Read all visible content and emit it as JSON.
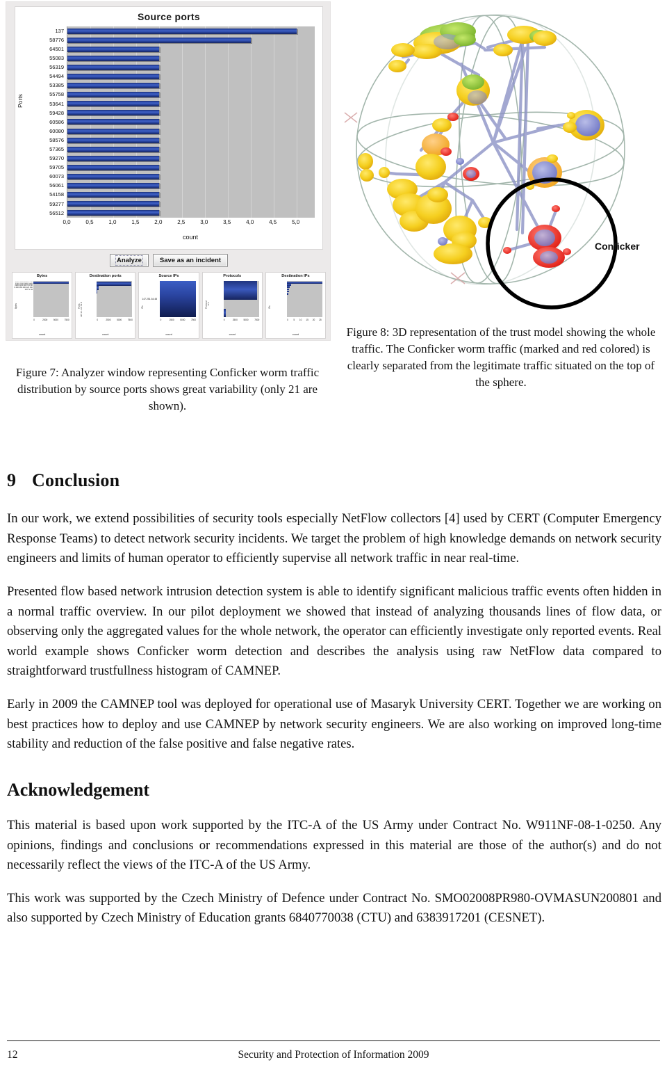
{
  "figure7": {
    "window_name": "Analyzer window",
    "chart_title": "Source ports",
    "buttons": [
      {
        "label": "Analyze",
        "name": "analyze-button"
      },
      {
        "label": "Save as an incident",
        "name": "save-as-incident-button"
      }
    ],
    "mini_charts": [
      {
        "title": "Bytes",
        "ylabel": "Bytes",
        "xlabel": "count",
        "xticks": [
          "0",
          "2500",
          "5000",
          "7500"
        ],
        "yticks": "4050 3564 3080 2700 2400 2100 1800 1560 1320 1100 920 740 600 480 380 290 220 160 110 72 44",
        "bars": [
          100
        ]
      },
      {
        "title": "Destination ports",
        "ylabel": "Ports",
        "xlabel": "count",
        "xticks": [
          "0",
          "2500",
          "5000",
          "7500"
        ],
        "yticks": "445  3  1  137  50  80",
        "bars": [
          97,
          5,
          2
        ]
      },
      {
        "title": "Source IPs",
        "ylabel": "IPs",
        "xlabel": "count",
        "xticks": [
          "0",
          "2500",
          "5000",
          "7500"
        ],
        "side_value": "147.251.54.48",
        "bars": [
          100
        ]
      },
      {
        "title": "Protocols",
        "ylabel": "Protocol",
        "xlabel": "count",
        "xticks": [
          "0",
          "2500",
          "5000",
          "7500"
        ],
        "yticks": "17   6",
        "bars": [
          96,
          2
        ]
      },
      {
        "title": "Destination IPs",
        "ylabel": "IPs",
        "xlabel": "count",
        "xticks": [
          "0",
          "5",
          "10",
          "15",
          "20",
          "25"
        ],
        "bars": [
          100,
          12,
          9,
          7,
          6,
          5
        ]
      }
    ]
  },
  "chart_data": {
    "type": "bar",
    "orientation": "horizontal",
    "title": "Source ports",
    "xlabel": "count",
    "ylabel": "Ports",
    "xlim": [
      0,
      5.4
    ],
    "xticks": [
      "0,0",
      "0,5",
      "1,0",
      "1,5",
      "2,0",
      "2,5",
      "3,0",
      "3,5",
      "4,0",
      "4,5",
      "5,0"
    ],
    "xtick_values": [
      0,
      0.5,
      1.0,
      1.5,
      2.0,
      2.5,
      3.0,
      3.5,
      4.0,
      4.5,
      5.0
    ],
    "grid": true,
    "legend": "none",
    "categories": [
      "137",
      "58776",
      "64501",
      "55083",
      "56319",
      "54494",
      "53385",
      "55758",
      "53641",
      "59428",
      "60586",
      "60080",
      "58576",
      "57365",
      "59270",
      "59705",
      "60073",
      "56061",
      "54158",
      "59277",
      "56512"
    ],
    "values": [
      5,
      4,
      2,
      2,
      2,
      2,
      2,
      2,
      2,
      2,
      2,
      2,
      2,
      2,
      2,
      2,
      2,
      2,
      2,
      2,
      2
    ],
    "bar_color": "#27409c",
    "plot_background": "#c0c0c0",
    "note": "Only 21 source ports are shown"
  },
  "figure8": {
    "annotation_label": "Conficker"
  },
  "captions": {
    "figure7": "Figure 7: Analyzer window representing Conficker worm traffic distribution by source ports shows great variability (only 21 are shown).",
    "figure8": "Figure 8: 3D representation of the trust model showing the whole traffic. The Conficker worm traffic (marked and red colored) is clearly separated from the legitimate traffic situated on the top of the sphere."
  },
  "conclusion": {
    "number": "9",
    "heading": "Conclusion",
    "paragraphs": [
      "In our work, we extend possibilities of security tools especially NetFlow collectors [4] used by CERT (Computer Emergency Response Teams) to detect network security incidents. We target the problem of high knowledge demands on network security engineers and limits of human operator to efficiently supervise all network traffic in near real-time.",
      "Presented flow based network intrusion detection system is able to identify significant malicious traffic events often hidden in a normal traffic overview. In our pilot deployment we showed that instead of analyzing thousands lines of flow data, or observing only the aggregated values for the whole network, the operator can efficiently investigate only reported events. Real world example shows Conficker worm detection and describes the analysis using raw NetFlow data compared to straightforward trustfullness histogram of CAMNEP.",
      "Early in 2009 the CAMNEP tool was deployed for operational use of Masaryk University CERT. Together we are working on best practices how to deploy and use CAMNEP by network security engineers. We are also working on improved long-time stability and reduction of the false positive and false negative rates."
    ]
  },
  "acknowledgement": {
    "heading": "Acknowledgement",
    "paragraphs": [
      "This material is based upon work supported by the ITC-A of the US Army under Contract No. W911NF-08-1-0250. Any opinions, findings and conclusions or recommendations expressed in this material are those of the author(s) and do not necessarily reflect the views of the ITC-A of the US Army.",
      "This work was supported by the Czech Ministry of Defence under Contract No. SMO02008PR980-OVMASUN200801 and also supported by Czech Ministry of Education grants 6840770038 (CTU) and 6383917201 (CESNET)."
    ]
  },
  "footer": {
    "page_number": "12",
    "center_text": "Security and Protection of Information 2009"
  }
}
